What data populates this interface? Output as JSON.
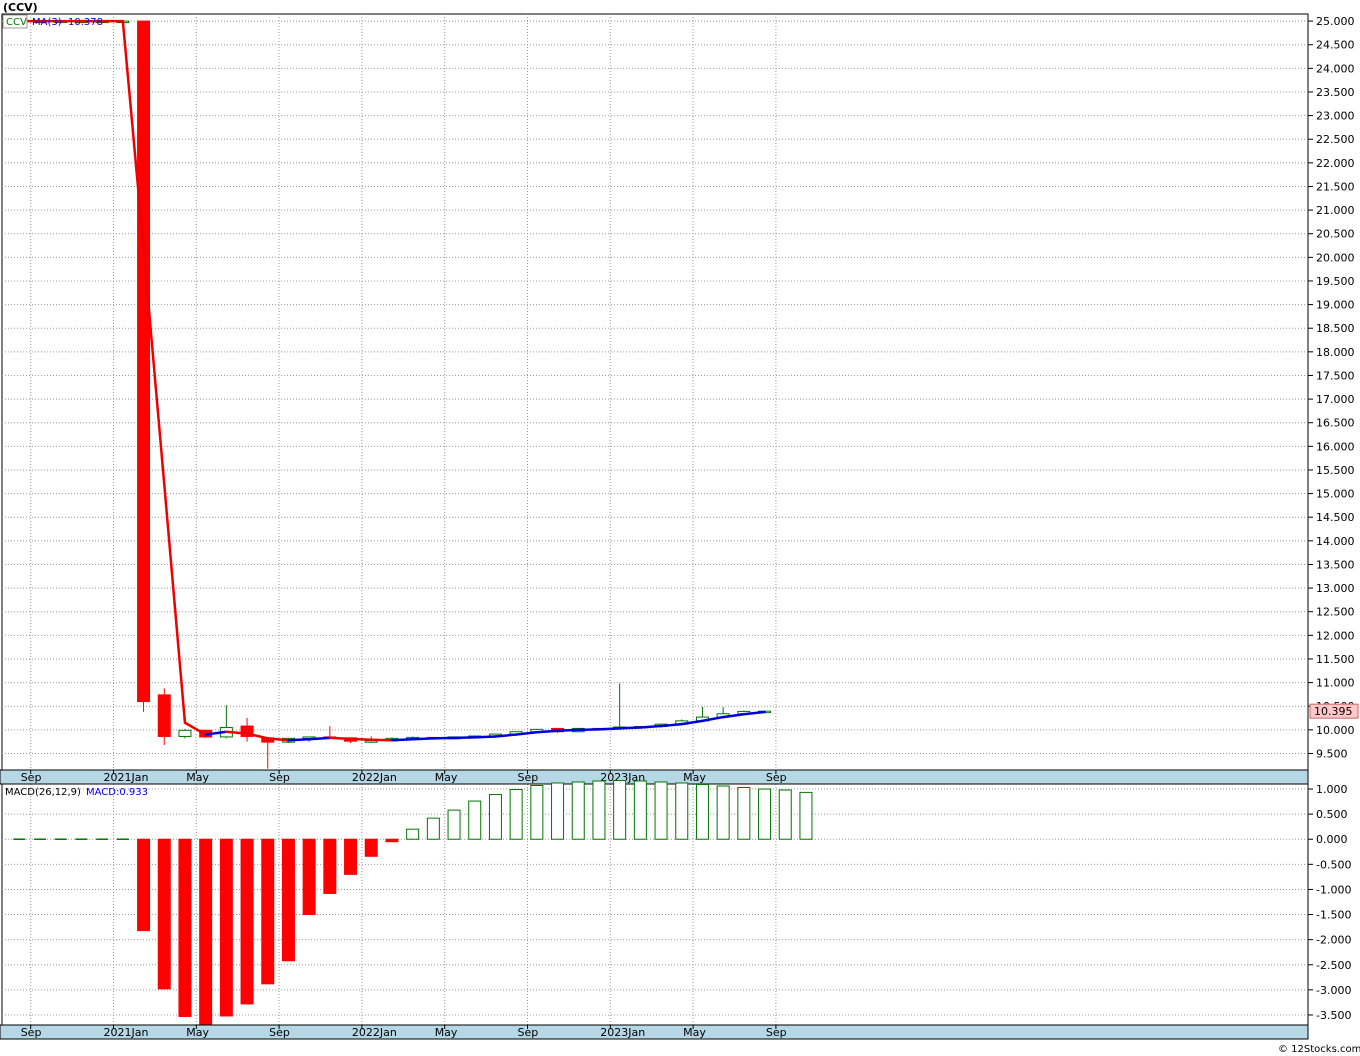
{
  "header": {
    "symbol": "(CCV)"
  },
  "price_panel": {
    "legend_symbol": "CCV",
    "legend_ma_name": "MA(3)",
    "legend_ma_value": "10.378",
    "last_price_tag": "10.395"
  },
  "macd_panel": {
    "legend_name": "MACD(26,12,9)",
    "legend_value": "MACD:0.933"
  },
  "footer": {
    "credit": "© 12Stocks.com"
  },
  "colors": {
    "up": "#007700",
    "down": "#ff0000",
    "ma_up": "#0000dd",
    "ma_down": "#ee0000",
    "axis_band": "#b6d7e6",
    "grid": "#999999",
    "price_tag_bg": "#ffc8c8"
  },
  "chart_data": [
    {
      "type": "candlestick",
      "name": "price",
      "x_tick_labels": [
        "Sep",
        "2021Jan",
        "May",
        "Sep",
        "2022Jan",
        "May",
        "Sep",
        "2023Jan",
        "May",
        "Sep"
      ],
      "y_tick_labels": [
        "25.000",
        "24.500",
        "24.000",
        "23.500",
        "23.000",
        "22.500",
        "22.000",
        "21.500",
        "21.000",
        "20.500",
        "20.000",
        "19.500",
        "19.000",
        "18.500",
        "18.000",
        "17.500",
        "17.000",
        "16.500",
        "16.000",
        "15.500",
        "15.000",
        "14.500",
        "14.000",
        "13.500",
        "13.000",
        "12.500",
        "12.000",
        "11.500",
        "11.000",
        "10.500",
        "10.000",
        "9.500"
      ],
      "ylim": [
        9.15,
        25.15
      ],
      "months": [
        "2020-08",
        "2020-09",
        "2020-10",
        "2020-11",
        "2020-12",
        "2021-01",
        "2021-02",
        "2021-03",
        "2021-04",
        "2021-05",
        "2021-06",
        "2021-07",
        "2021-08",
        "2021-09",
        "2021-10",
        "2021-11",
        "2021-12",
        "2022-01",
        "2022-02",
        "2022-03",
        "2022-04",
        "2022-05",
        "2022-06",
        "2022-07",
        "2022-08",
        "2022-09",
        "2022-10",
        "2022-11",
        "2022-12",
        "2023-01",
        "2023-02",
        "2023-03",
        "2023-04",
        "2023-05",
        "2023-06",
        "2023-07",
        "2023-08",
        "2023-09",
        "2023-10"
      ],
      "candles": [
        {
          "o": 25.0,
          "h": 25.0,
          "l": 25.0,
          "c": 25.0
        },
        {
          "o": 25.0,
          "h": 25.0,
          "l": 25.0,
          "c": 25.0
        },
        {
          "o": 25.0,
          "h": 25.0,
          "l": 25.0,
          "c": 25.0
        },
        {
          "o": 25.0,
          "h": 25.0,
          "l": 25.0,
          "c": 25.0
        },
        {
          "o": 25.0,
          "h": 25.0,
          "l": 25.0,
          "c": 25.0
        },
        {
          "o": 25.0,
          "h": 25.0,
          "l": 25.0,
          "c": 25.0
        },
        {
          "o": 25.0,
          "h": 25.0,
          "l": 10.38,
          "c": 10.6
        },
        {
          "o": 10.74,
          "h": 10.88,
          "l": 9.68,
          "c": 9.86
        },
        {
          "o": 9.86,
          "h": 10.02,
          "l": 9.82,
          "c": 9.99
        },
        {
          "o": 9.99,
          "h": 10.0,
          "l": 9.83,
          "c": 9.85
        },
        {
          "o": 9.85,
          "h": 10.52,
          "l": 9.82,
          "c": 10.05
        },
        {
          "o": 10.08,
          "h": 10.25,
          "l": 9.75,
          "c": 9.86
        },
        {
          "o": 9.83,
          "h": 9.84,
          "l": 9.18,
          "c": 9.74
        },
        {
          "o": 9.74,
          "h": 9.83,
          "l": 9.72,
          "c": 9.82
        },
        {
          "o": 9.82,
          "h": 9.84,
          "l": 9.75,
          "c": 9.85
        },
        {
          "o": 9.85,
          "h": 10.08,
          "l": 9.8,
          "c": 9.83
        },
        {
          "o": 9.83,
          "h": 9.84,
          "l": 9.72,
          "c": 9.76
        },
        {
          "o": 9.76,
          "h": 9.86,
          "l": 9.73,
          "c": 9.77
        },
        {
          "o": 9.77,
          "h": 9.84,
          "l": 9.76,
          "c": 9.82
        },
        {
          "o": 9.82,
          "h": 9.86,
          "l": 9.8,
          "c": 9.84
        },
        {
          "o": 9.84,
          "h": 9.85,
          "l": 9.8,
          "c": 9.81
        },
        {
          "o": 9.81,
          "h": 9.86,
          "l": 9.8,
          "c": 9.85
        },
        {
          "o": 9.85,
          "h": 9.88,
          "l": 9.84,
          "c": 9.87
        },
        {
          "o": 9.87,
          "h": 9.92,
          "l": 9.86,
          "c": 9.91
        },
        {
          "o": 9.91,
          "h": 9.96,
          "l": 9.9,
          "c": 9.96
        },
        {
          "o": 9.96,
          "h": 10.02,
          "l": 9.95,
          "c": 10.01
        },
        {
          "o": 10.03,
          "h": 10.04,
          "l": 9.93,
          "c": 9.96
        },
        {
          "o": 9.96,
          "h": 10.04,
          "l": 9.95,
          "c": 10.03
        },
        {
          "o": 10.03,
          "h": 10.04,
          "l": 10.0,
          "c": 10.01
        },
        {
          "o": 10.04,
          "h": 10.98,
          "l": 10.03,
          "c": 10.06
        },
        {
          "o": 10.06,
          "h": 10.08,
          "l": 10.05,
          "c": 10.07
        },
        {
          "o": 10.07,
          "h": 10.13,
          "l": 10.06,
          "c": 10.12
        },
        {
          "o": 10.12,
          "h": 10.22,
          "l": 10.1,
          "c": 10.19
        },
        {
          "o": 10.19,
          "h": 10.49,
          "l": 10.17,
          "c": 10.27
        },
        {
          "o": 10.27,
          "h": 10.48,
          "l": 10.25,
          "c": 10.34
        },
        {
          "o": 10.34,
          "h": 10.41,
          "l": 10.32,
          "c": 10.39
        },
        {
          "o": 10.39,
          "h": 10.41,
          "l": 10.38,
          "c": 10.395
        }
      ],
      "ma3": [
        25.0,
        25.0,
        25.0,
        25.0,
        25.0,
        25.0,
        20.2,
        15.2,
        10.15,
        9.9,
        9.96,
        9.92,
        9.82,
        9.78,
        9.8,
        9.83,
        9.81,
        9.79,
        9.78,
        9.8,
        9.82,
        9.83,
        9.84,
        9.86,
        9.9,
        9.95,
        9.98,
        10.0,
        10.01,
        10.03,
        10.05,
        10.08,
        10.12,
        10.19,
        10.27,
        10.33,
        10.378
      ]
    },
    {
      "type": "bar",
      "name": "macd",
      "y_tick_labels": [
        "1.000",
        "0.500",
        "0.000",
        "-0.500",
        "-1.000",
        "-1.500",
        "-2.000",
        "-2.500",
        "-3.000",
        "-3.500"
      ],
      "ylim": [
        -3.7,
        1.1
      ],
      "values": [
        0.0,
        0.0,
        0.0,
        0.0,
        0.0,
        0.0,
        -1.82,
        -2.98,
        -3.53,
        -3.68,
        -3.52,
        -3.28,
        -2.88,
        -2.42,
        -1.5,
        -1.08,
        -0.7,
        -0.34,
        -0.05,
        0.2,
        0.42,
        0.58,
        0.76,
        0.89,
        0.99,
        1.07,
        1.12,
        1.14,
        1.16,
        1.17,
        1.16,
        1.14,
        1.12,
        1.09,
        1.06,
        1.03,
        1.0,
        0.98,
        0.933
      ]
    }
  ]
}
